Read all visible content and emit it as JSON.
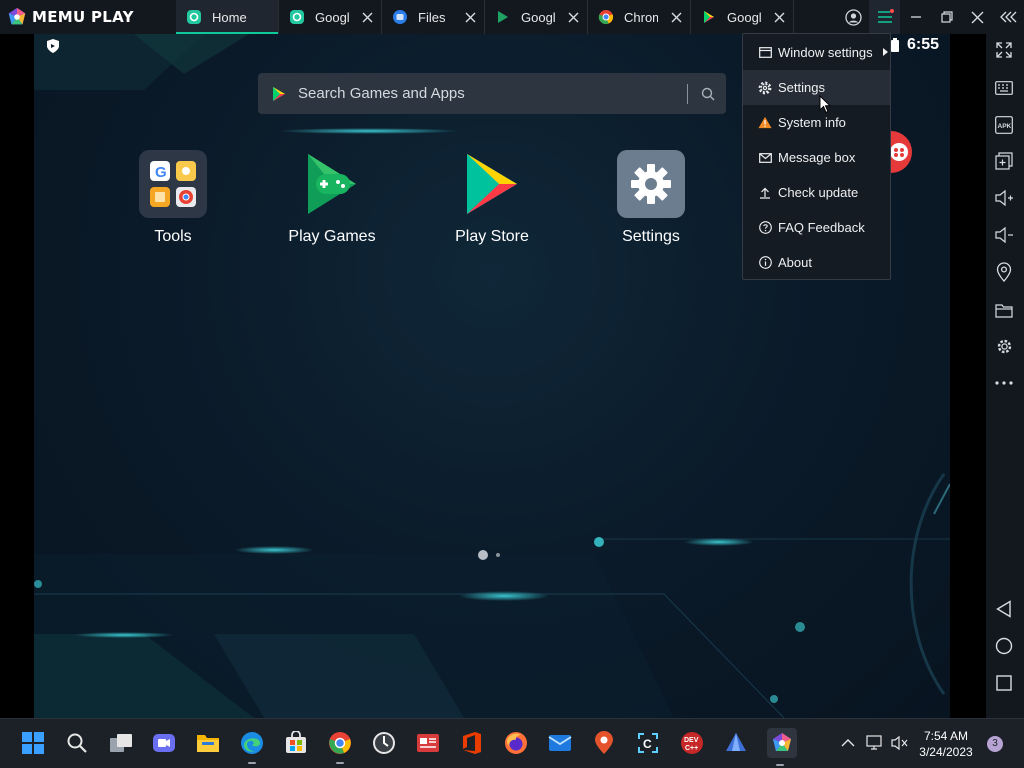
{
  "app": {
    "brand": "MEMU PLAY"
  },
  "tabs": [
    {
      "label": "Home",
      "icon": "memu-home-icon",
      "active": true
    },
    {
      "label": "Google",
      "icon": "google-green-icon"
    },
    {
      "label": "Files",
      "icon": "files-icon"
    },
    {
      "label": "Google",
      "icon": "google-play-green-icon"
    },
    {
      "label": "Chrome",
      "icon": "chrome-icon"
    },
    {
      "label": "Google",
      "icon": "google-play-icon"
    }
  ],
  "android": {
    "clock": "6:55",
    "search": {
      "placeholder": "Search Games and Apps"
    },
    "apps": [
      {
        "label": "Tools"
      },
      {
        "label": "Play Games"
      },
      {
        "label": "Play Store"
      },
      {
        "label": "Settings"
      }
    ]
  },
  "menu": {
    "items": [
      {
        "label": "Window settings",
        "icon": "window-icon"
      },
      {
        "label": "Settings",
        "icon": "gear-icon"
      },
      {
        "label": "System info",
        "icon": "warning-icon"
      },
      {
        "label": "Message box",
        "icon": "mail-icon"
      },
      {
        "label": "Check update",
        "icon": "upload-icon"
      },
      {
        "label": "FAQ  Feedback",
        "icon": "help-icon"
      },
      {
        "label": "About",
        "icon": "info-icon"
      }
    ]
  },
  "taskbar": {
    "time": "7:54 AM",
    "date": "3/24/2023",
    "notifications": "3"
  },
  "colors": {
    "accent": "#10c99a",
    "warning": "#f08a24",
    "badge": "#e63a3a"
  }
}
